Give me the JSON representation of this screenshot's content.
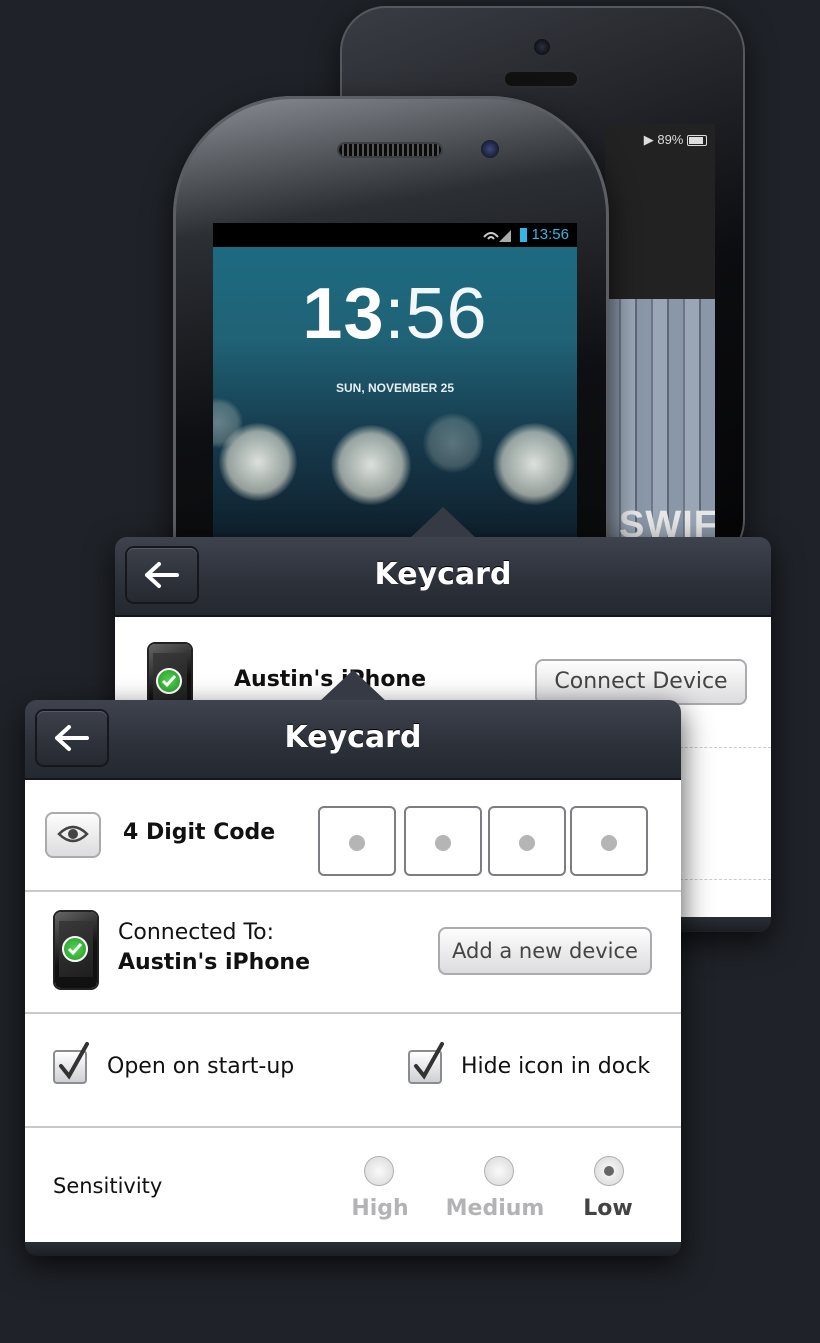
{
  "background_devices": {
    "iphone": {
      "battery": "89%",
      "album_text": "SWIFT"
    },
    "android": {
      "status_time": "13:56",
      "clock_hours": "13",
      "clock_minutes": ":56",
      "date": "SUN, NOVEMBER 25"
    }
  },
  "panel_back": {
    "title": "Keycard",
    "device_name": "Austin's iPhone",
    "connect_button": "Connect Device"
  },
  "panel_front": {
    "title": "Keycard",
    "code": {
      "label": "4 Digit Code",
      "digits": 4
    },
    "connection": {
      "label": "Connected To:",
      "device": "Austin's iPhone",
      "add_button": "Add a new device"
    },
    "options": [
      {
        "label": "Open on start-up",
        "checked": true
      },
      {
        "label": "Hide icon in dock",
        "checked": true
      }
    ],
    "sensitivity": {
      "label": "Sensitivity",
      "levels": [
        "High",
        "Medium",
        "Low"
      ],
      "selected": "Low"
    }
  },
  "colors": {
    "accent_android": "#33b5e5",
    "header": "#2c3039",
    "check_green": "#1e9a1e"
  }
}
